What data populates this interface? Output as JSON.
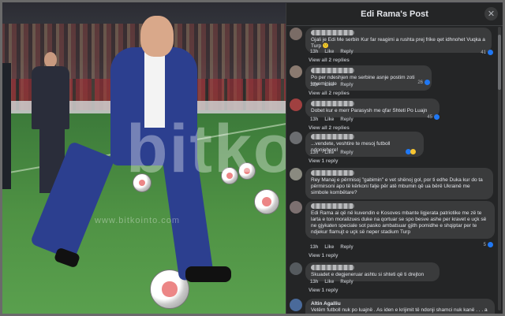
{
  "photo": {
    "watermark": "bitko",
    "watermark_sub": "www.bitkointo.com"
  },
  "panel": {
    "title": "Edi Rama's Post",
    "close_icon": "close-icon"
  },
  "comments": [
    {
      "text": "Gjali je Edi Me serbin Kur far reagimi a rushta prej frike qet idhnohet Vuqka a Turp 🙁",
      "time": "13h",
      "like": "Like",
      "reply": "Reply",
      "reactions": "41",
      "view": "View all 2 replies"
    },
    {
      "text": "Po per ndeshjen me serbine asnje postim zoti kryeministe",
      "time": "13h",
      "like": "Like",
      "reply": "Reply",
      "reactions": "26",
      "view": "View all 2 replies"
    },
    {
      "text": "Dobet kur e merr Parasysh me qfar Shteti Po Luajn",
      "time": "13h",
      "like": "Like",
      "reply": "Reply",
      "reactions": "45",
      "view": "View all 2 replies"
    },
    {
      "text": "...vendete, veshtire te mesoj futboll ndonjehere!",
      "time": "13h",
      "like": "Like",
      "reply": "Reply",
      "reactions": "",
      "view": "View 1 reply"
    },
    {
      "text": "Rey Manaj e përmisoj \"gabimin\" e vet shënoj gol, por ti edhe Duka kur do ta përmirsoni apo të kërkoni falje për atë mbumin që ua bërë Ukrainë me simbole kombëtare?",
      "time": "",
      "like": "",
      "reply": "",
      "reactions": "",
      "view": ""
    },
    {
      "text": "Edi Rama ai që në kuvendin e Kosoves mbante ligjerata patriotike me zë te larta e ton moralizues duke na qortuar se spo besve ashe per kravet e uçk së ne gjykaten speciale sot pasko ambatsuar gjith pomidhe e shqiptar per te ndjekur flamujt e uçk së neper stadium Turp",
      "time": "13h",
      "like": "Like",
      "reply": "Reply",
      "reactions": "5",
      "view": "View 1 reply"
    },
    {
      "text": "Skuadet e degjeneruar ashtu si shteti që ti drejton",
      "time": "13h",
      "like": "Like",
      "reply": "Reply",
      "reactions": "",
      "view": "View 1 reply"
    },
    {
      "name": "Altin Agalliu",
      "text": "Vetëm futboll nuk po luajnë . As iden e krijimit të ndonji shamci nuk kanë . . . a mjerë ne futbollin e mjerë që kemi",
      "time": "",
      "like": "",
      "reply": "",
      "reactions": "",
      "view": ""
    }
  ]
}
